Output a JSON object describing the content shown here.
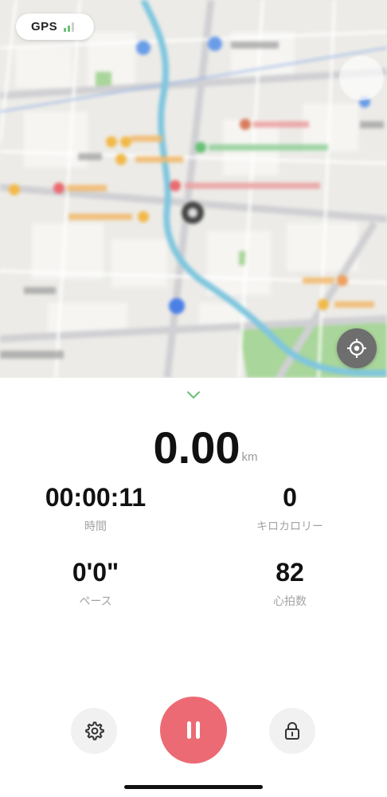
{
  "map": {
    "gps_label": "GPS",
    "signal_bars_active": 2,
    "signal_bars_total": 3,
    "colors": {
      "signal_active": "#67c275",
      "signal_inactive": "#cfcfcf",
      "map_background": "#ecebe7",
      "water": "#7fc6df",
      "park": "#9ccf8a",
      "road": "#d4d4d6"
    }
  },
  "stats": {
    "distance": {
      "value": "0.00",
      "unit": "km"
    },
    "time": {
      "value": "00:00:11",
      "label": "時間"
    },
    "calories": {
      "value": "0",
      "label": "キロカロリー"
    },
    "pace": {
      "value": "0'0\"",
      "label": "ペース"
    },
    "heart_rate": {
      "value": "82",
      "label": "心拍数"
    }
  },
  "controls": {
    "collapse_icon": "chevron-down-icon",
    "settings_icon": "gear-icon",
    "pause_icon": "pause-icon",
    "lock_icon": "lock-icon",
    "colors": {
      "accent": "#ec6a74",
      "chevron": "#67c275",
      "button_bg": "#f1f1f1"
    }
  }
}
